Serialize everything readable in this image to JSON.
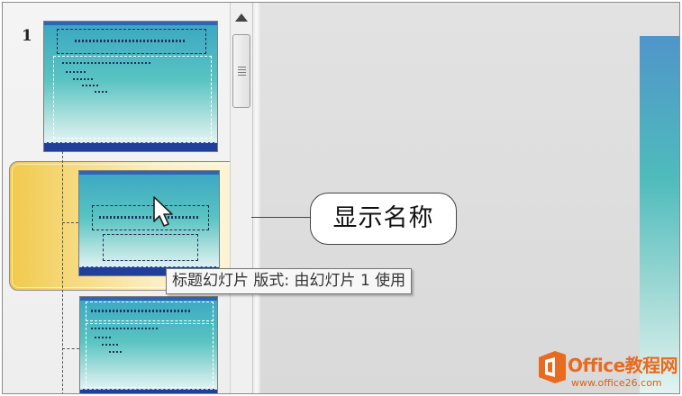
{
  "thumbnail_pane": {
    "first_slide_number": "1"
  },
  "callout": {
    "text": "显示名称"
  },
  "tooltip": {
    "text": "标题幻灯片 版式: 由幻灯片 1 使用"
  },
  "watermark": {
    "title": "Office教程网",
    "url": "www.office26.com"
  },
  "colors": {
    "selection_gold": "#f1c94a",
    "slide_teal": "#59c4c2",
    "footer_blue": "#1f3f9a",
    "watermark_orange": "#e86b1f"
  },
  "icons": [
    "scroll-up-arrow-icon",
    "mouse-pointer-icon",
    "office-logo-icon"
  ]
}
